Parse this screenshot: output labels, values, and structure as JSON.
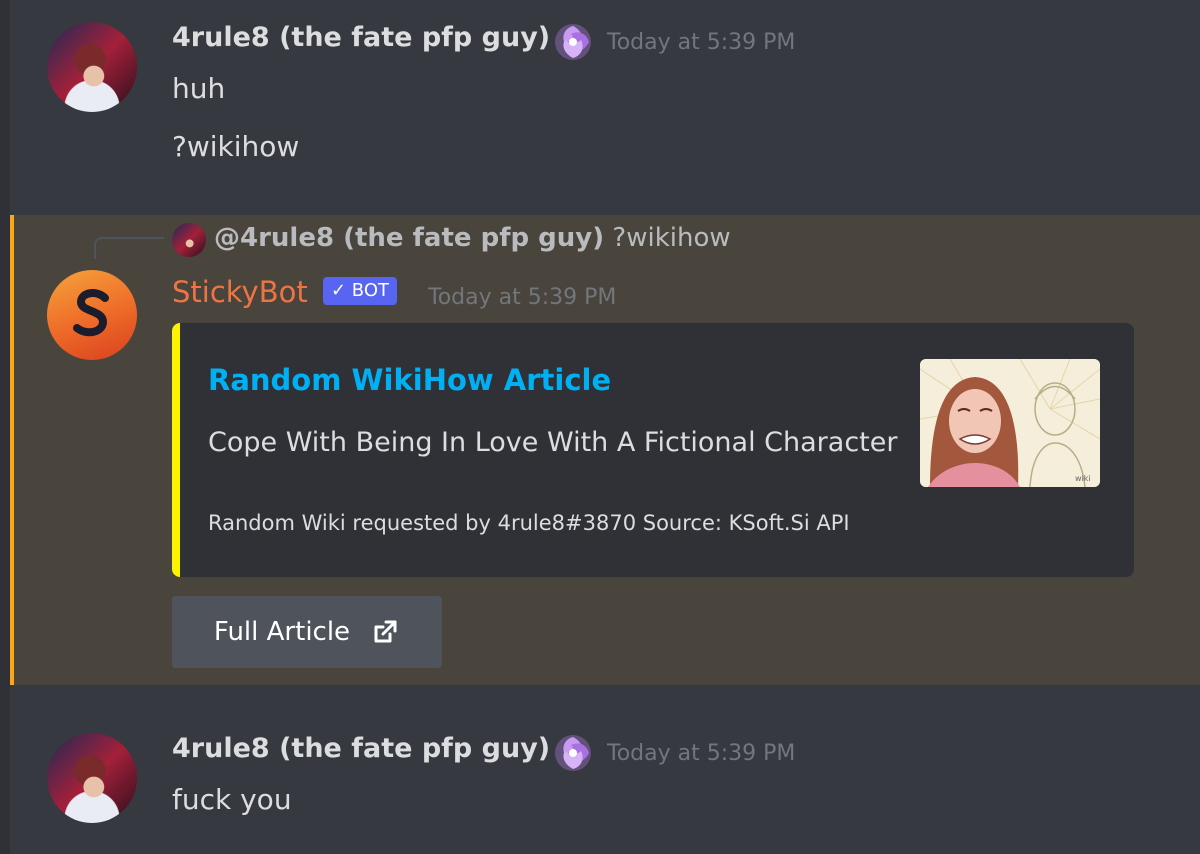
{
  "messages": [
    {
      "author": "4rule8 (the fate pfp guy)",
      "timestamp": "Today at 5:39 PM",
      "lines": [
        "huh",
        "?wikihow"
      ]
    },
    {
      "author": "4rule8 (the fate pfp guy)",
      "timestamp": "Today at 5:39 PM",
      "lines": [
        "fuck you"
      ]
    }
  ],
  "bot_message": {
    "reply": {
      "mention": "@4rule8 (the fate pfp guy)",
      "text": "?wikihow"
    },
    "author": "StickyBot",
    "tag": "✓ BOT",
    "timestamp": "Today at 5:39 PM",
    "embed": {
      "title": "Random WikiHow Article",
      "description": "Cope With Being In Love With A Fictional Character",
      "footer": "Random Wiki requested by 4rule8#3870 Source: KSoft.Si API",
      "accent_color": "#fcf303",
      "thumbnail_watermark": "wiki"
    },
    "button": {
      "label": "Full Article",
      "icon": "external-link-icon"
    }
  },
  "colors": {
    "background": "#36393f",
    "mention_highlight": "#49443c",
    "mention_border": "#faa81a",
    "bot_name": "#ee7443",
    "bot_tag": "#5865f2",
    "link": "#00b0f4"
  }
}
